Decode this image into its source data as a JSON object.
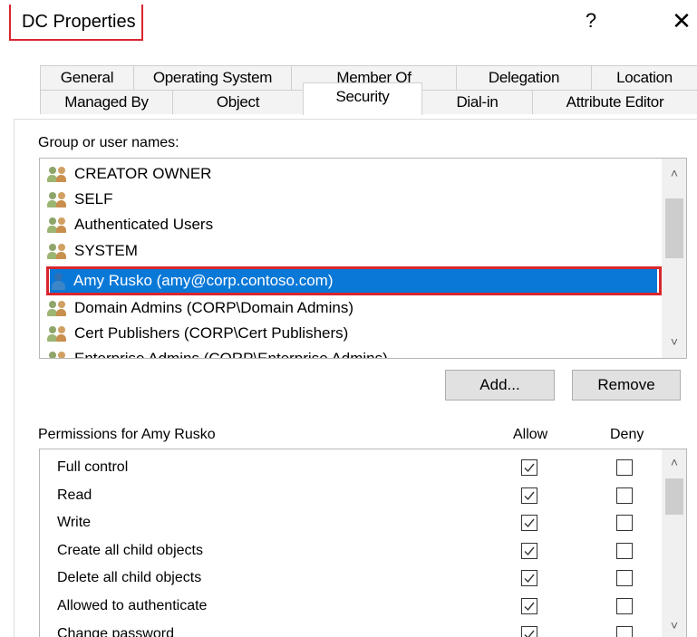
{
  "window": {
    "title": "DC Properties",
    "help_label": "?",
    "close_label": "✕"
  },
  "tabs": {
    "row1": [
      "General",
      "Operating System",
      "Member Of",
      "Delegation",
      "Location"
    ],
    "row2": [
      "Managed By",
      "Object",
      "Security",
      "Dial-in",
      "Attribute Editor"
    ],
    "active": "Security"
  },
  "group_section": {
    "label": "Group or user names:",
    "items": [
      {
        "name": "CREATOR OWNER",
        "icon": "group-icon"
      },
      {
        "name": "SELF",
        "icon": "group-icon"
      },
      {
        "name": "Authenticated Users",
        "icon": "group-icon"
      },
      {
        "name": "SYSTEM",
        "icon": "group-icon"
      },
      {
        "name": "Amy Rusko (amy@corp.contoso.com)",
        "icon": "user-icon",
        "selected": true
      },
      {
        "name": "Domain Admins (CORP\\Domain Admins)",
        "icon": "group-icon"
      },
      {
        "name": "Cert Publishers (CORP\\Cert Publishers)",
        "icon": "group-icon"
      },
      {
        "name": "Enterprise Admins (CORP\\Enterprise Admins)",
        "icon": "group-icon"
      }
    ],
    "add_label": "Add...",
    "remove_label": "Remove"
  },
  "permissions": {
    "label": "Permissions for Amy Rusko",
    "allow_label": "Allow",
    "deny_label": "Deny",
    "rows": [
      {
        "name": "Full control",
        "allow": true,
        "deny": false
      },
      {
        "name": "Read",
        "allow": true,
        "deny": false
      },
      {
        "name": "Write",
        "allow": true,
        "deny": false
      },
      {
        "name": "Create all child objects",
        "allow": true,
        "deny": false
      },
      {
        "name": "Delete all child objects",
        "allow": true,
        "deny": false
      },
      {
        "name": "Allowed to authenticate",
        "allow": true,
        "deny": false
      },
      {
        "name": "Change password",
        "allow": true,
        "deny": false
      }
    ]
  },
  "colors": {
    "selection": "#0a78d7",
    "highlight_outline": "#d9262e"
  }
}
